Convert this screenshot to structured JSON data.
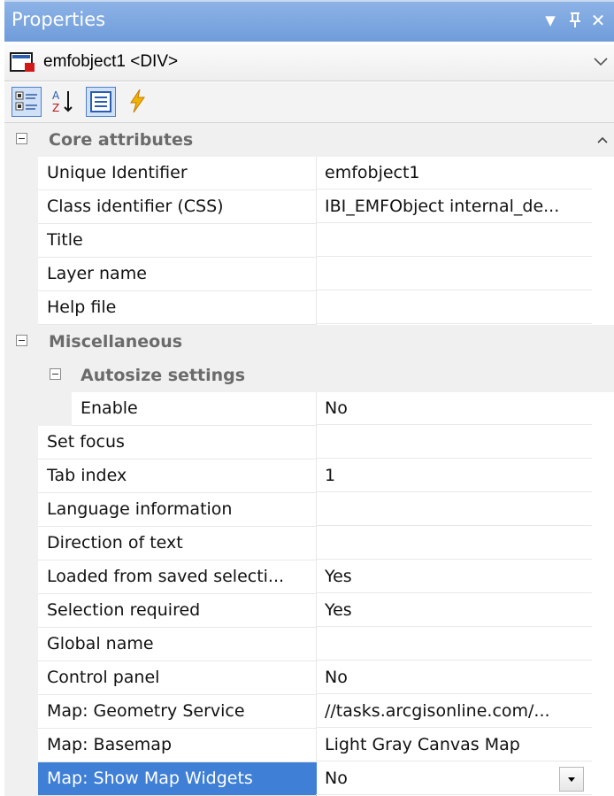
{
  "panel": {
    "title": "Properties",
    "pin_glyph": "▼",
    "dock_glyph": "ᴨ",
    "close_glyph": "✕"
  },
  "object_selector": {
    "value": "emfobject1 <DIV>"
  },
  "toolbar": {
    "buttons": [
      {
        "name": "categorized-icon",
        "active": true
      },
      {
        "name": "alphabetical-icon",
        "active": false
      },
      {
        "name": "properties-icon",
        "active": true
      },
      {
        "name": "events-icon",
        "active": false
      }
    ]
  },
  "grid": {
    "categories": {
      "core": "Core attributes",
      "misc": "Miscellaneous",
      "autosize": "Autosize settings"
    },
    "rows": [
      {
        "name": "Unique Identifier",
        "value": "emfobject1"
      },
      {
        "name": "Class identifier (CSS)",
        "value": "IBI_EMFObject internal_de..."
      },
      {
        "name": "Title",
        "value": ""
      },
      {
        "name": "Layer name",
        "value": ""
      },
      {
        "name": "Help file",
        "value": ""
      },
      {
        "name": "Enable",
        "value": "No"
      },
      {
        "name": "Set focus",
        "value": ""
      },
      {
        "name": "Tab index",
        "value": "1"
      },
      {
        "name": "Language information",
        "value": ""
      },
      {
        "name": "Direction of text",
        "value": ""
      },
      {
        "name": "Loaded from saved selecti...",
        "value": "Yes"
      },
      {
        "name": "Selection required",
        "value": "Yes"
      },
      {
        "name": "Global name",
        "value": ""
      },
      {
        "name": "Control panel",
        "value": "No"
      },
      {
        "name": "Map: Geometry Service",
        "value": "//tasks.arcgisonline.com/..."
      },
      {
        "name": "Map: Basemap",
        "value": "Light Gray Canvas Map"
      },
      {
        "name": "Map: Show Map Widgets",
        "value": "No"
      }
    ]
  }
}
